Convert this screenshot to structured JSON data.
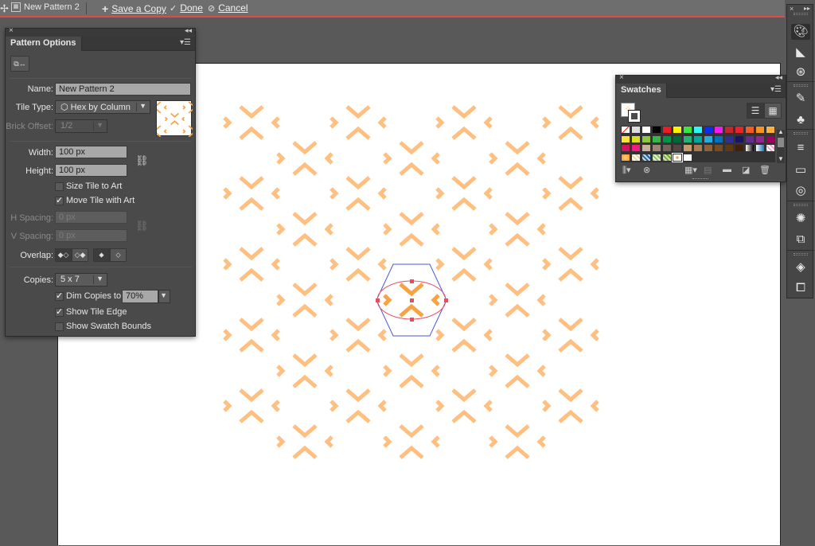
{
  "topbar": {
    "document_title": "New Pattern 2",
    "save_copy_label": "Save a Copy",
    "done_label": "Done",
    "cancel_label": "Cancel"
  },
  "pattern_options": {
    "tab_label": "Pattern Options",
    "name_label": "Name:",
    "name_value": "New Pattern 2",
    "tile_type_label": "Tile Type:",
    "tile_type_value": "Hex by Column",
    "brick_offset_label": "Brick Offset:",
    "brick_offset_value": "1/2",
    "width_label": "Width:",
    "width_value": "100 px",
    "height_label": "Height:",
    "height_value": "100 px",
    "size_tile_to_art_label": "Size Tile to Art",
    "size_tile_to_art_checked": false,
    "move_tile_with_art_label": "Move Tile with Art",
    "move_tile_with_art_checked": true,
    "h_spacing_label": "H Spacing:",
    "h_spacing_value": "0 px",
    "v_spacing_label": "V Spacing:",
    "v_spacing_value": "0 px",
    "overlap_label": "Overlap:",
    "copies_label": "Copies:",
    "copies_value": "5 x 7",
    "dim_copies_label": "Dim Copies to:",
    "dim_copies_checked": true,
    "dim_copies_value": "70%",
    "show_tile_edge_label": "Show Tile Edge",
    "show_tile_edge_checked": true,
    "show_swatch_bounds_label": "Show Swatch Bounds",
    "show_swatch_bounds_checked": false
  },
  "swatches": {
    "tab_label": "Swatches",
    "rows": [
      [
        "none",
        "registration",
        "#ffffff",
        "#000000",
        "#ed1c24",
        "#fff200",
        "#39e639",
        "#2ff5f5",
        "#0c2ef2",
        "#f21cf2",
        "#c1272d",
        "#e8232b",
        "#f15a24",
        "#f7931e",
        "#fbb040"
      ],
      [
        "#fbe33a",
        "#d7df23",
        "#8dc63f",
        "#39b54a",
        "#009245",
        "#006837",
        "#22b573",
        "#00a99d",
        "#29abe2",
        "#0071bc",
        "#2e3192",
        "#1b1464",
        "#662d91",
        "#93278f",
        "#9e005d"
      ],
      [
        "#d4145a",
        "#ed1e79",
        "#c7b299",
        "#998675",
        "#736357",
        "#534741",
        "#c69c6d",
        "#a67c52",
        "#8c6239",
        "#754c24",
        "#603813",
        "#42210b",
        "gradient-bw",
        "gradient-blue",
        "gradient-pink"
      ],
      [
        "radial-orange",
        "pattern-1",
        "pattern-2",
        "pattern-3",
        "pattern-4",
        "pattern-current",
        "#ffffff"
      ]
    ]
  },
  "canvas": {
    "motif_color": "#ffbf80",
    "motif_selected_color": "#f7a343",
    "tile_edge_color": "#4a56e0",
    "selection_color": "#ee4b5a",
    "copies": "5 x 7"
  },
  "dock": {
    "icons": [
      "color-palette-icon",
      "color-guide-icon",
      "symbols-network-icon",
      "brushes-icon",
      "club-symbol-icon",
      "stroke-icon",
      "gradient-icon",
      "transparency-icon",
      "appearance-icon",
      "graphic-styles-icon",
      "layers-icon",
      "artboards-icon"
    ]
  }
}
